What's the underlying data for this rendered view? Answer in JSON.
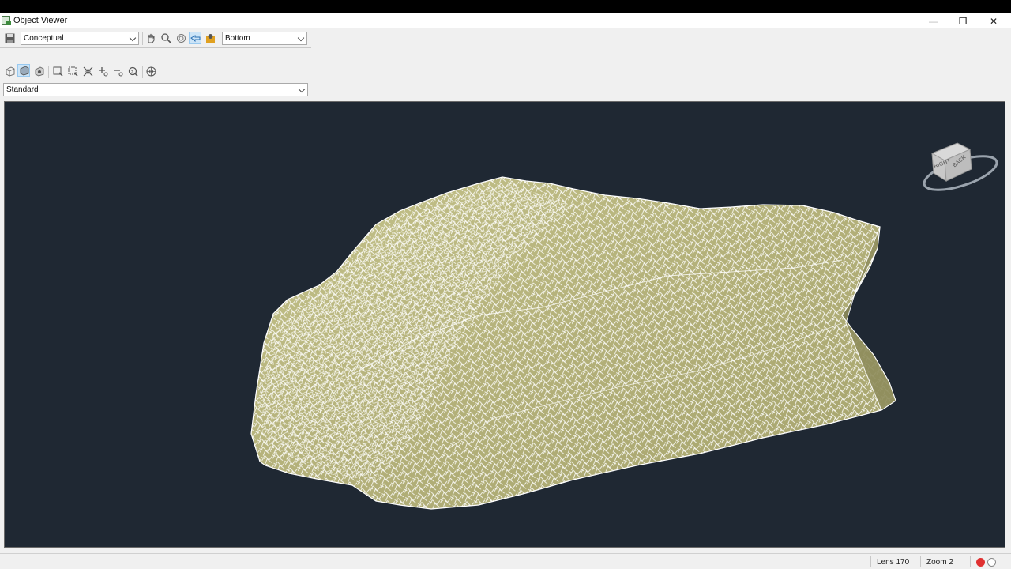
{
  "window": {
    "title": "Object Viewer"
  },
  "toolbar": {
    "visual_style": "Conceptual",
    "view_direction": "Bottom",
    "view_preset": "Standard",
    "icons": [
      "save-icon",
      "pan-icon",
      "zoom-icon",
      "orbit-icon",
      "free-orbit-icon",
      "camera-icon",
      "wireframe-view-icon",
      "shaded-view-icon",
      "render-view-icon",
      "zoom-window-icon",
      "zoom-extents-icon",
      "zoom-all-icon",
      "zoom-in-icon",
      "zoom-out-icon",
      "zoom-realtime-icon",
      "steering-wheel-icon"
    ]
  },
  "viewcube": {
    "face_right": "RIGHT",
    "face_back": "BACK"
  },
  "status": {
    "lens": "Lens 170",
    "zoom": "Zoom 2"
  },
  "colors": {
    "viewport_bg": "#1f2833",
    "mesh_fill": "#b8b57a",
    "mesh_edges": "#ffffff",
    "record_dot": "#e03030"
  }
}
